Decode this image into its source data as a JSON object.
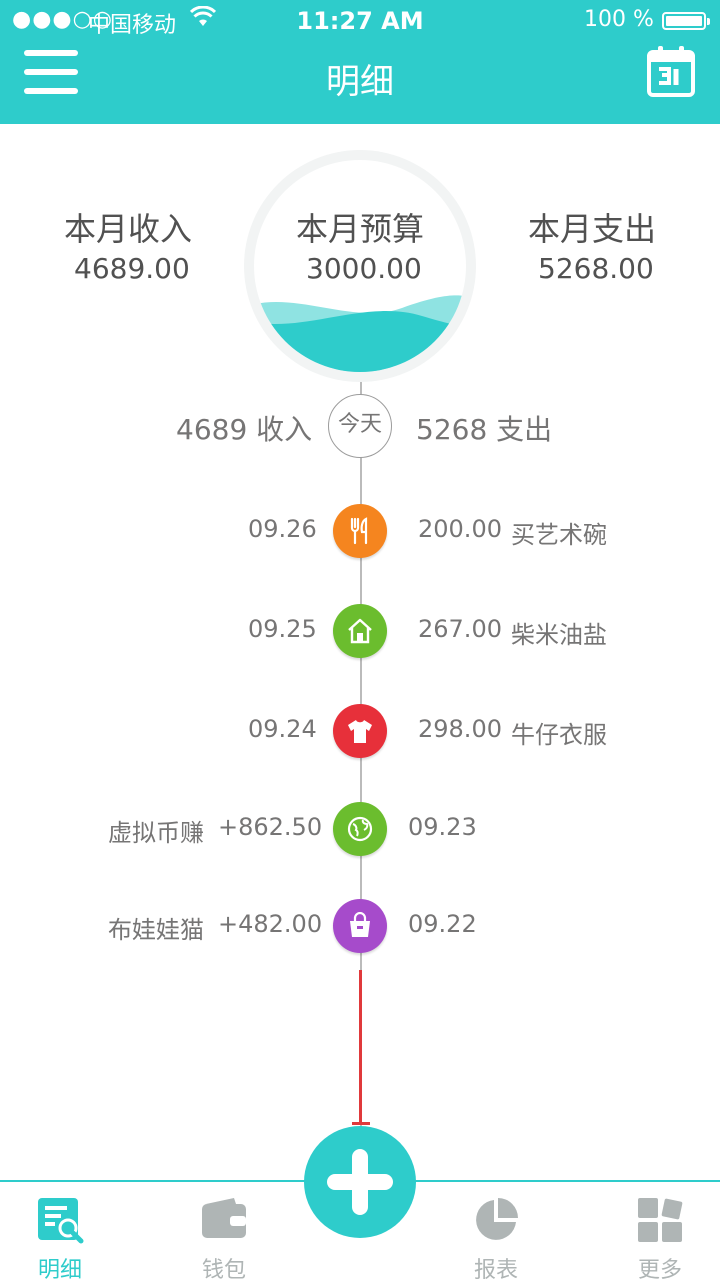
{
  "status_bar": {
    "signal": "●●●○○",
    "carrier": "中国移动",
    "time": "11:27 AM",
    "battery": "100 %"
  },
  "header": {
    "title": "明细"
  },
  "summary": {
    "income_label": "本月收入",
    "income_value": "4689.00",
    "budget_label": "本月预算",
    "budget_value": "3000.00",
    "expense_label": "本月支出",
    "expense_value": "5268.00"
  },
  "today": {
    "income_value": "4689",
    "income_label": "收入",
    "center_label": "今天",
    "expense_value": "5268",
    "expense_label": "支出"
  },
  "entries": [
    {
      "date": "09.26",
      "amount": "200.00",
      "note": "买艺术碗",
      "icon": "utensils-icon",
      "color": "#F5851F"
    },
    {
      "date": "09.25",
      "amount": "267.00",
      "note": "柴米油盐",
      "icon": "house-icon",
      "color": "#6BBD2E"
    },
    {
      "date": "09.24",
      "amount": "298.00",
      "note": "牛仔衣服",
      "icon": "shirt-icon",
      "color": "#E7303A"
    },
    {
      "date": "09.23",
      "amount": "+862.50",
      "note": "虚拟币赚",
      "icon": "globe-icon",
      "color": "#6BBD2E"
    },
    {
      "date": "09.22",
      "amount": "+482.00",
      "note": "布娃娃猫",
      "icon": "bag-icon",
      "color": "#A64BCB"
    }
  ],
  "tabs": [
    {
      "label": "明细",
      "icon": "list-search-icon"
    },
    {
      "label": "钱包",
      "icon": "wallet-icon"
    },
    {
      "label": "报表",
      "icon": "pie-chart-icon"
    },
    {
      "label": "更多",
      "icon": "grid-icon"
    }
  ],
  "colors": {
    "accent": "#2ECCCB",
    "summary_text": "#515151",
    "row_text": "#767575",
    "tab_inactive": "#AFB5B5"
  }
}
